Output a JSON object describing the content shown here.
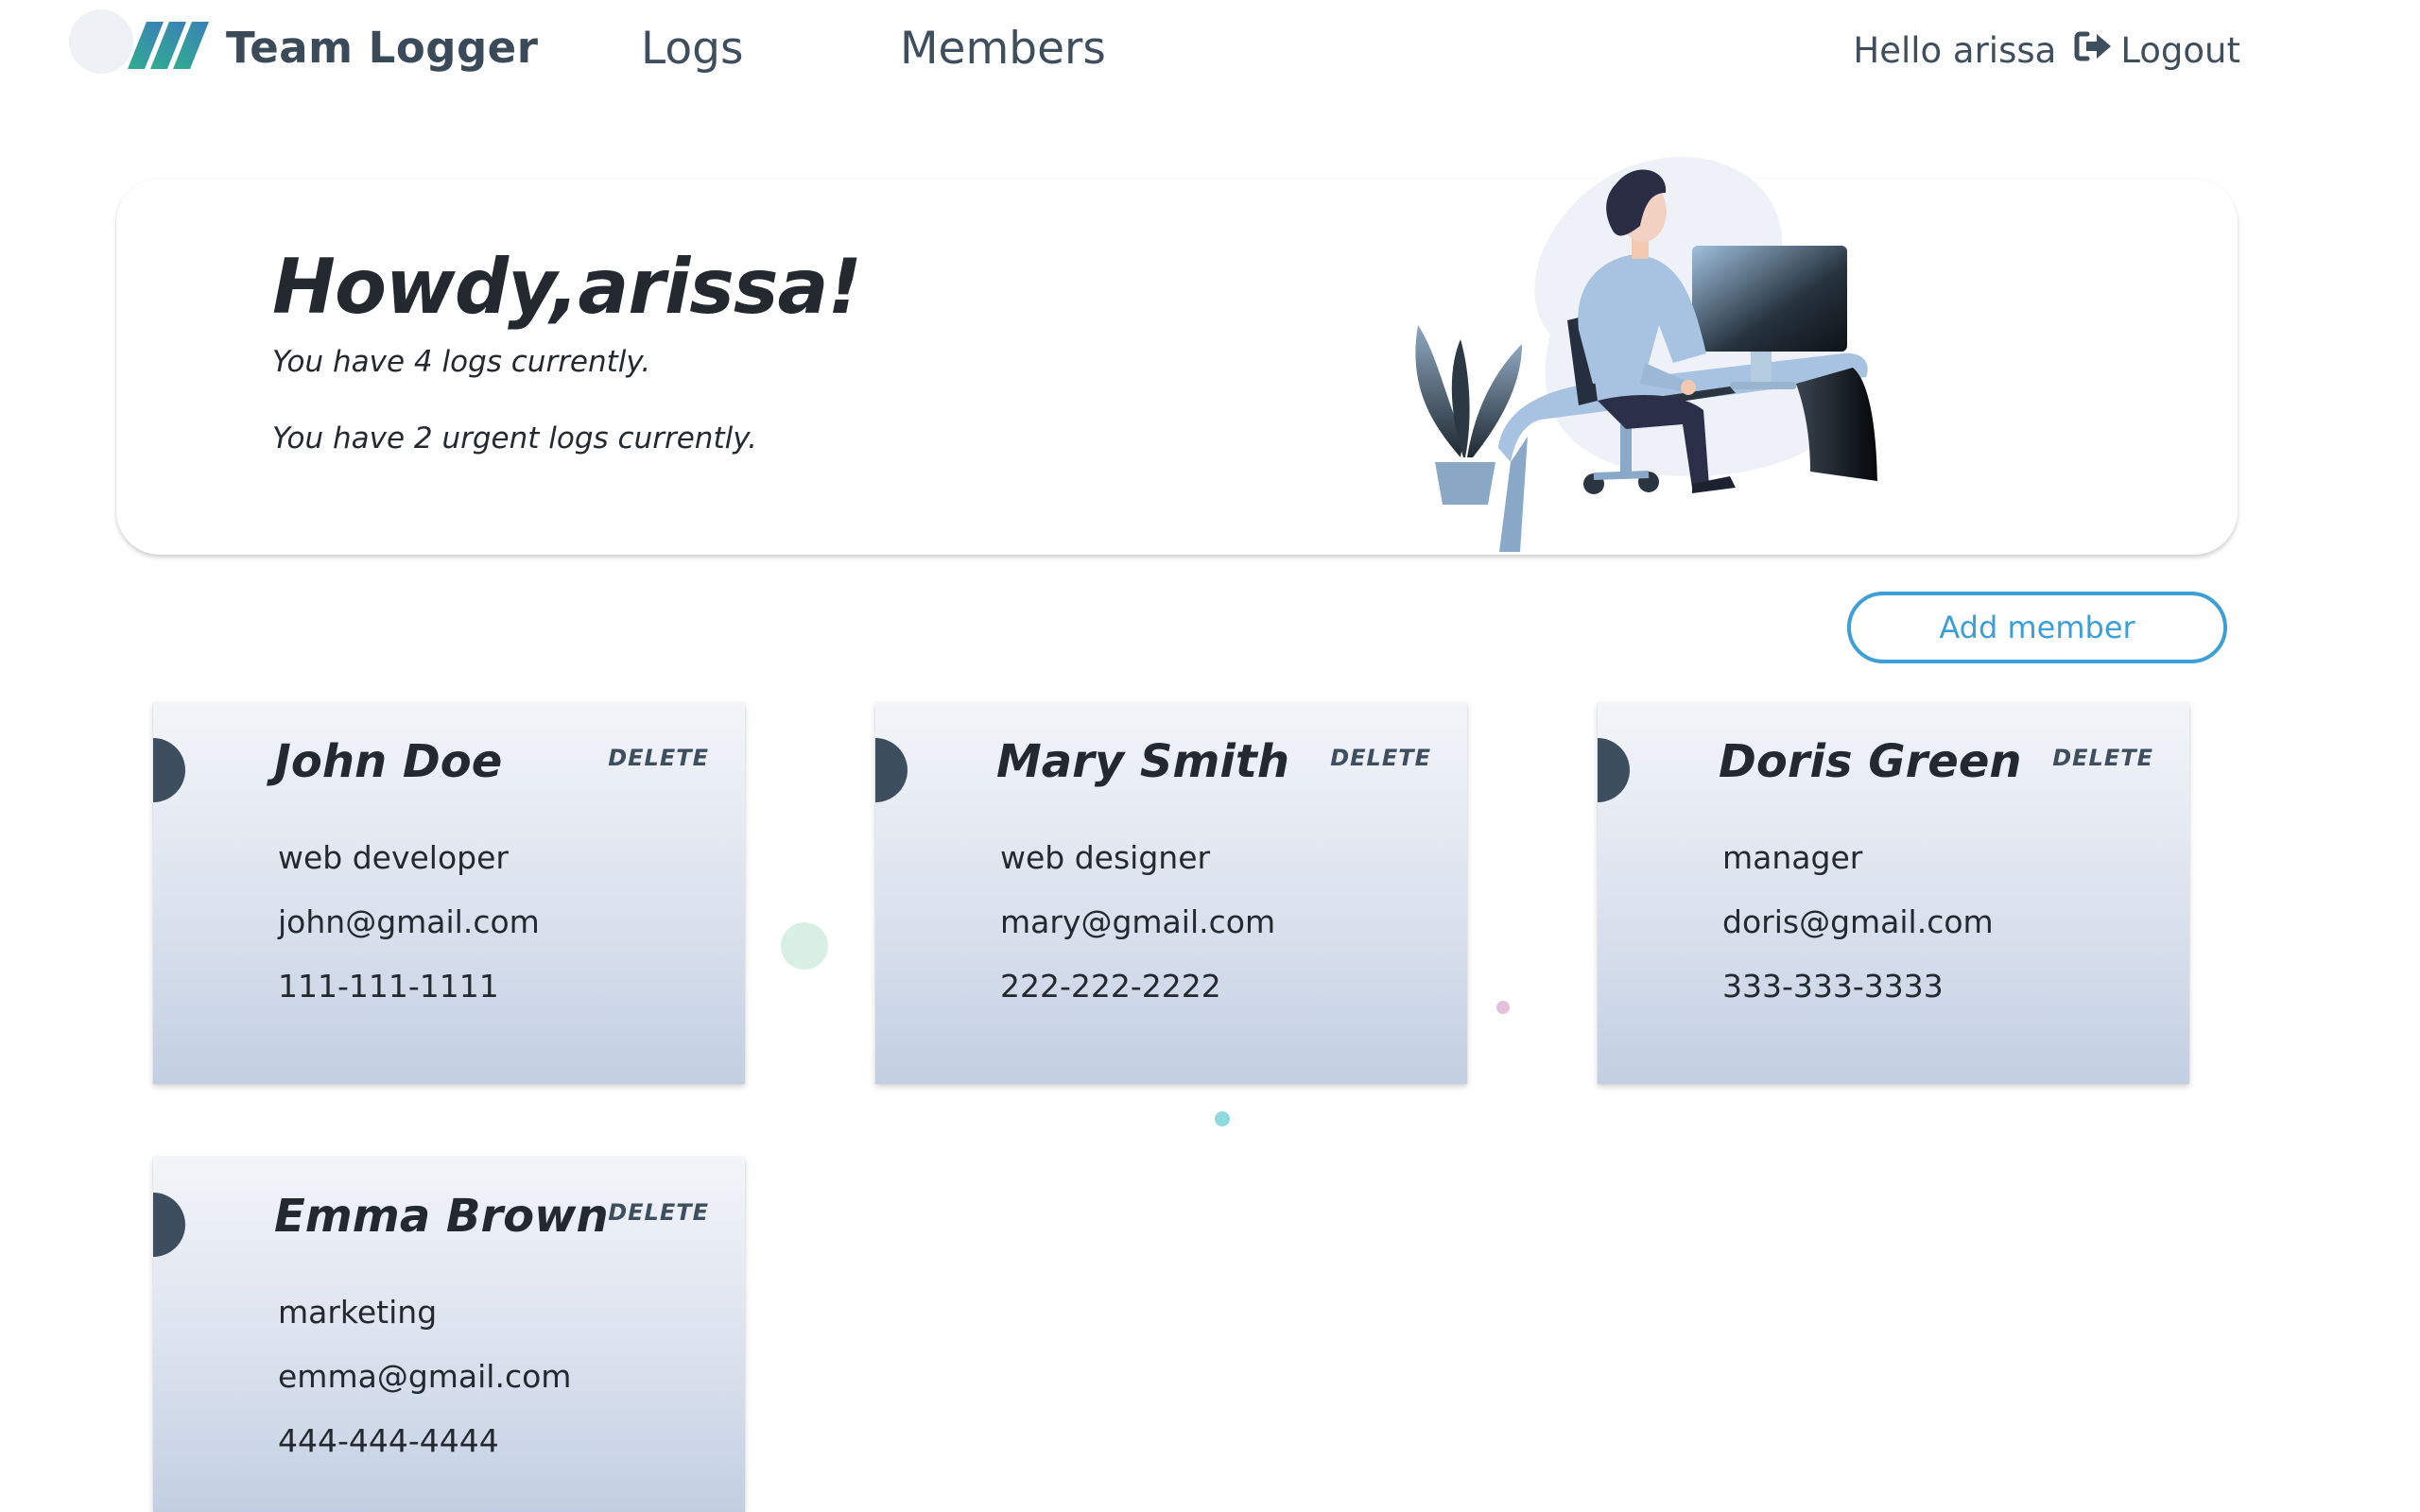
{
  "nav": {
    "brand": "Team Logger",
    "links": [
      "Logs",
      "Members"
    ],
    "greeting": "Hello arissa",
    "logout": "Logout"
  },
  "hero": {
    "title": "Howdy,arissa!",
    "line1": "You have 4 logs currently.",
    "line2": "You have 2 urgent logs currently."
  },
  "actions": {
    "add_member": "Add member"
  },
  "members": [
    {
      "name": "John Doe",
      "role": "web developer",
      "email": "john@gmail.com",
      "phone": "111-111-1111",
      "delete": "DELETE"
    },
    {
      "name": "Mary Smith",
      "role": "web designer",
      "email": "mary@gmail.com",
      "phone": "222-222-2222",
      "delete": "DELETE"
    },
    {
      "name": "Doris Green",
      "role": "manager",
      "email": "doris@gmail.com",
      "phone": "333-333-3333",
      "delete": "DELETE"
    },
    {
      "name": "Emma Brown",
      "role": "marketing",
      "email": "emma@gmail.com",
      "phone": "444-444-4444",
      "delete": "DELETE"
    }
  ],
  "colors": {
    "accent": "#3c9fd8",
    "logo_green": "#2fae8f",
    "logo_blue": "#3b7fb8",
    "text_dark": "#23292f",
    "card_dot": "#3d4e5e"
  },
  "icons": {
    "logo": "logo-stripes-icon",
    "logout": "logout-icon"
  }
}
